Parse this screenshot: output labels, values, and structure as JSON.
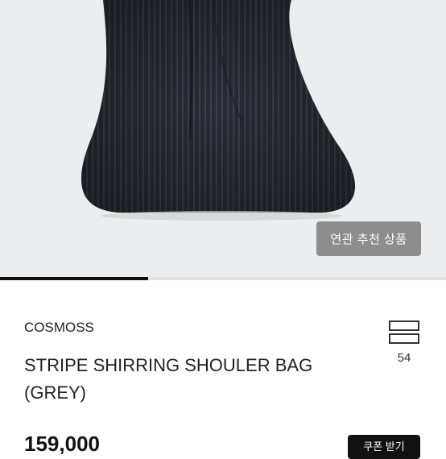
{
  "product_image": {
    "alt_icon": "product-photo"
  },
  "related_button": {
    "label": "연관 추천 상품"
  },
  "image_progress": {
    "fraction": 0.333
  },
  "product": {
    "brand": "COSMOSS",
    "title": "STRIPE SHIRRING SHOULER BAG (GREY)",
    "price": "159,000"
  },
  "wishlist": {
    "count": "54",
    "icon": "stack-icon"
  },
  "coupon": {
    "label": "쿠폰 받기"
  },
  "colors": {
    "accent": "#111111",
    "overlay": "#808080"
  }
}
